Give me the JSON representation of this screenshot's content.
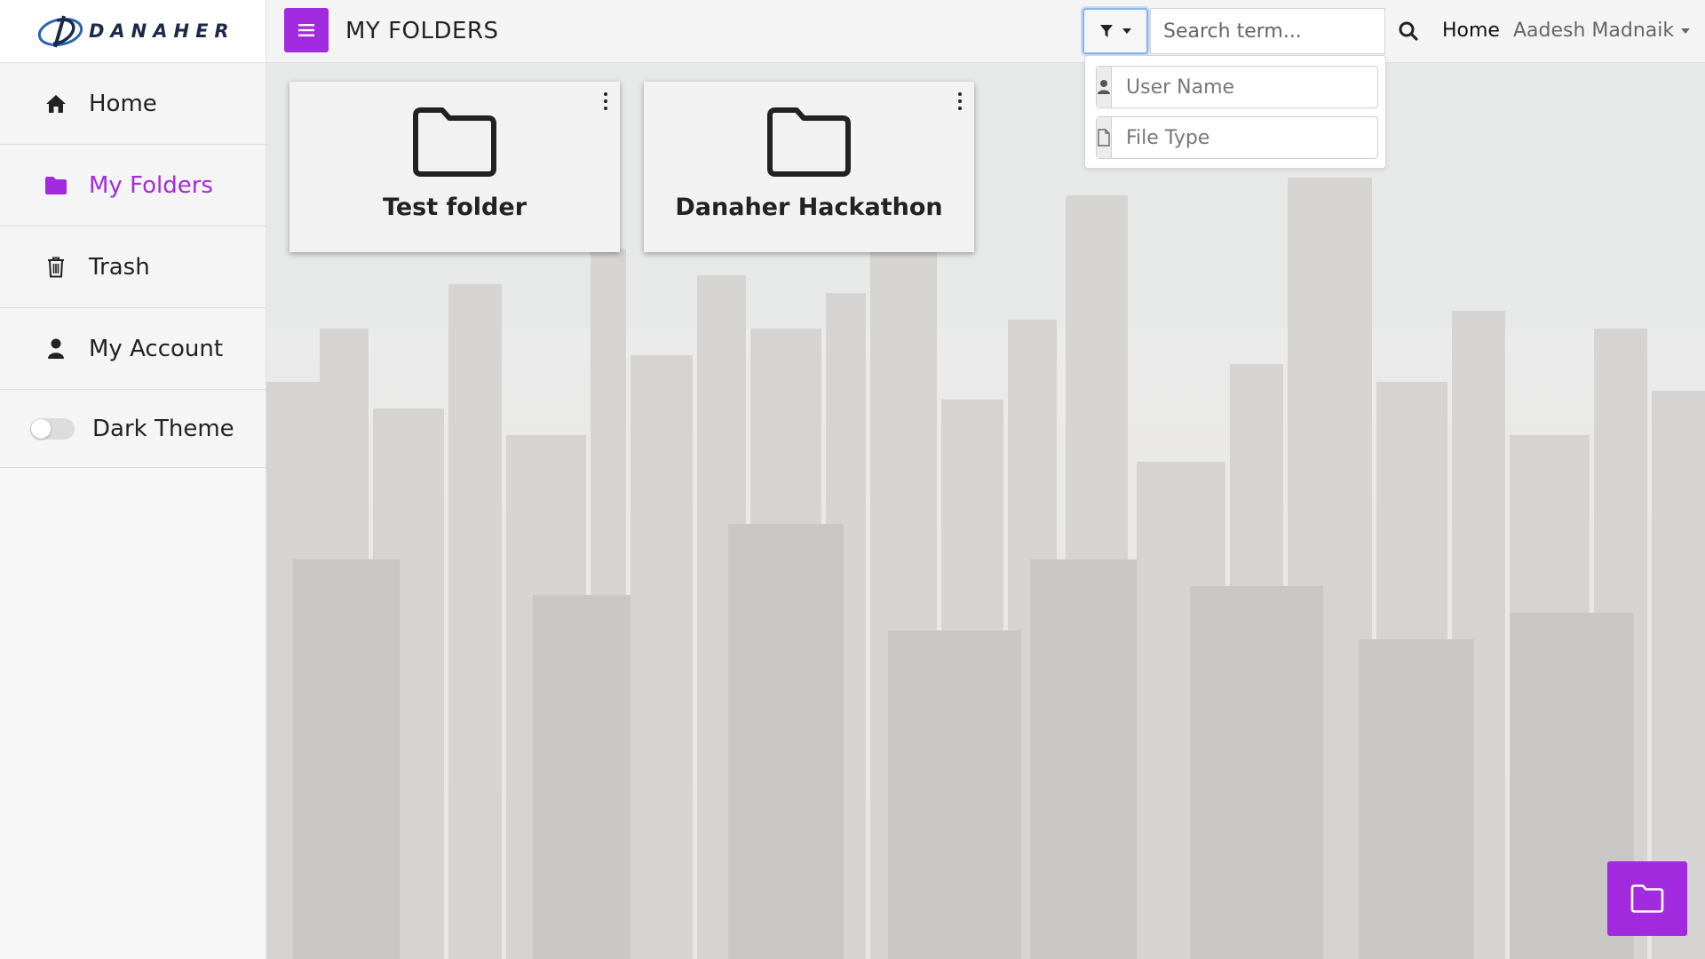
{
  "brand": {
    "name": "DANAHER"
  },
  "sidebar": {
    "items": [
      {
        "label": "Home",
        "icon": "home-icon"
      },
      {
        "label": "My Folders",
        "icon": "folder-icon",
        "active": true
      },
      {
        "label": "Trash",
        "icon": "trash-icon"
      },
      {
        "label": "My Account",
        "icon": "user-icon"
      }
    ],
    "theme_toggle": {
      "label": "Dark Theme",
      "enabled": false
    }
  },
  "header": {
    "title": "MY FOLDERS",
    "search_placeholder": "Search term...",
    "home_link": "Home",
    "user_name": "Aadesh Madnaik"
  },
  "filter_dropdown": {
    "user_name_placeholder": "User Name",
    "file_type_placeholder": "File Type"
  },
  "folders": [
    {
      "name": "Test folder"
    },
    {
      "name": "Danaher Hackathon"
    }
  ],
  "colors": {
    "accent": "#a22bdf",
    "focus_ring": "#85b5f0"
  }
}
